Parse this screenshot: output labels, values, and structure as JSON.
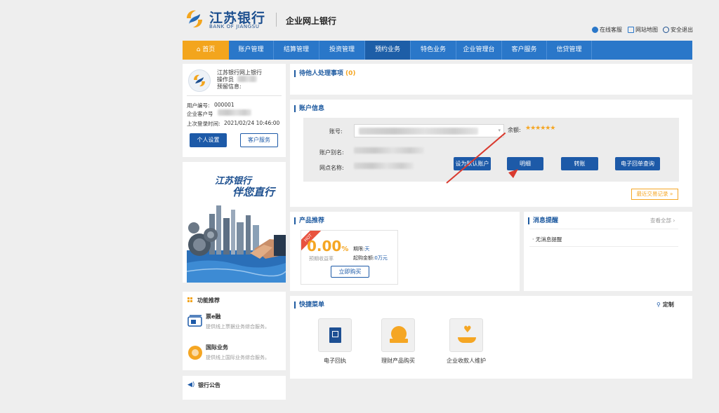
{
  "header": {
    "logo_cn": "江苏银行",
    "logo_en": "BANK OF JIANGSU",
    "title": "企业网上银行",
    "links": [
      "在线客服",
      "网站地图",
      "安全退出"
    ]
  },
  "nav": {
    "home": "首页",
    "items": [
      "账户管理",
      "结算管理",
      "投资管理",
      "预约业务",
      "特色业务",
      "企业管理台",
      "客户服务",
      "信贷管理"
    ]
  },
  "user": {
    "bank_name": "江苏银行网上银行",
    "operator_label": "操作员",
    "reserved_label": "预留信息:",
    "user_no_label": "用户编号:",
    "user_no": "000001",
    "customer_no_label": "企业客户号",
    "last_login_label": "上次登录时间:",
    "last_login": "2021/02/24 10:46:00",
    "settings_btn": "个人设置",
    "service_btn": "客户服务"
  },
  "banner": {
    "line1": "江苏银行",
    "line2": "伴您直行"
  },
  "features": {
    "title": "功能推荐",
    "items": [
      {
        "name": "票e融",
        "desc": "提供线上票据业务综合服务。"
      },
      {
        "name": "国际业务",
        "desc": "提供线上国际业务综合服务。"
      }
    ]
  },
  "notice": {
    "title": "银行公告"
  },
  "pending": {
    "title": "待他人处理事项",
    "count": "(0)"
  },
  "account": {
    "title": "账户信息",
    "account_no_label": "账号:",
    "balance_label": "余额:",
    "balance_mask": "★★★★★★",
    "alias_label": "账户别名:",
    "branch_label": "网点名称:",
    "buttons": [
      "设为默认账户",
      "明细",
      "转账",
      "电子回单查询"
    ],
    "recent_link": "最近交易记录",
    "recent_chevron": "»"
  },
  "product": {
    "title": "产品推荐",
    "hot": "HOT",
    "rate": "0.00",
    "rate_unit": "%",
    "rate_label": "预期收益率",
    "term_label": "期限:",
    "term_value": "天",
    "min_label": "起购金额:",
    "min_value": "0万元",
    "buy_btn": "立即购买"
  },
  "messages": {
    "title": "消息提醒",
    "view_all": "查看全部",
    "view_all_chevron": "›",
    "empty": "· 无消息提醒"
  },
  "quick": {
    "title": "快捷菜单",
    "customize": "定制",
    "items": [
      "电子回执",
      "理财产品购买",
      "企业收款人维护"
    ]
  },
  "colors": {
    "brand_blue": "#1d5aa8",
    "nav_blue": "#2a77c9",
    "home_orange": "#f3a51d",
    "accent_orange": "#f5a623",
    "annotation_red": "#d93a2f"
  }
}
